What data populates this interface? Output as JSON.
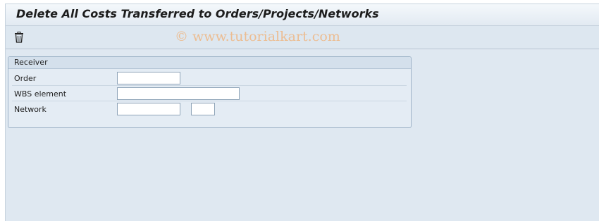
{
  "window": {
    "title": "Delete All Costs Transferred to Orders/Projects/Networks"
  },
  "toolbar": {
    "delete_icon": "trash-icon",
    "watermark": "© www.tutorialkart.com"
  },
  "receiver_group": {
    "title": "Receiver",
    "fields": [
      {
        "label": "Order",
        "value": ""
      },
      {
        "label": "WBS element",
        "value": ""
      },
      {
        "label": "Network",
        "value": "",
        "activity_value": ""
      }
    ]
  },
  "colors": {
    "background": "#dfe8f1",
    "watermark": "#ecbd92"
  }
}
